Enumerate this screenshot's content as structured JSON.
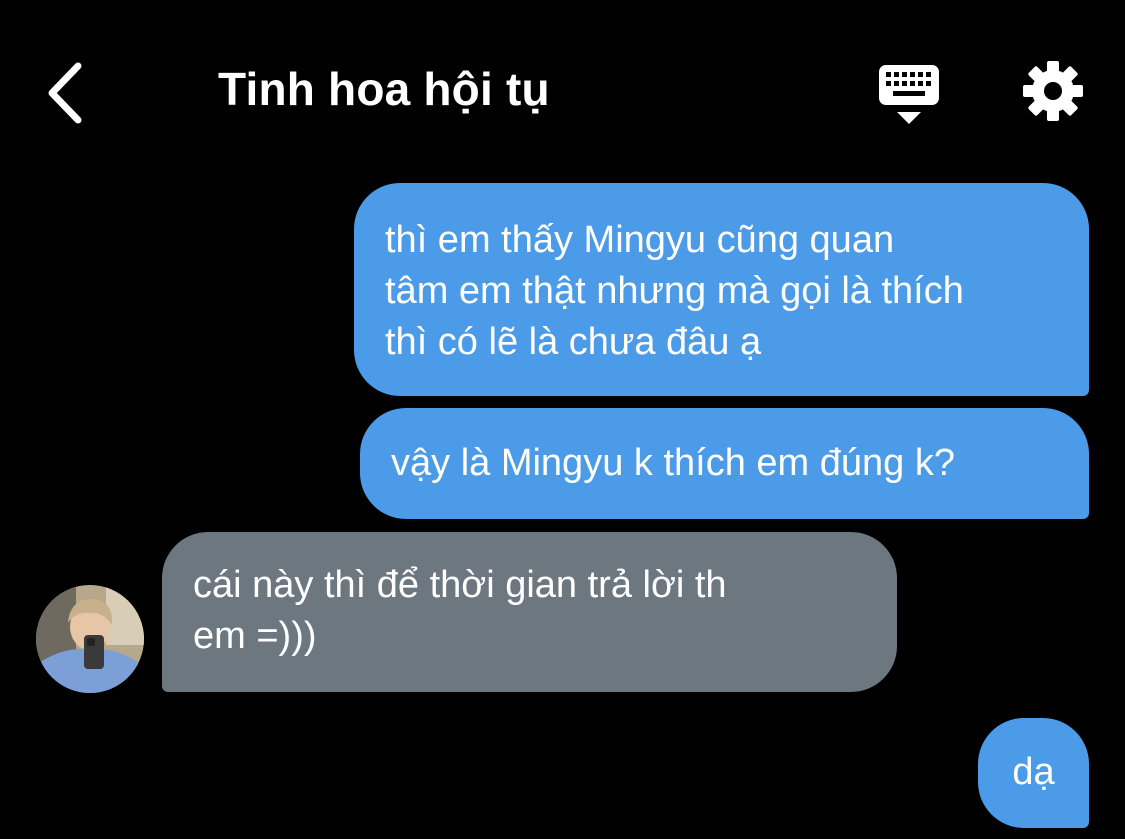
{
  "header": {
    "title": "Tinh hoa hội tụ",
    "back_icon": "chevron-left-icon",
    "keyboard_icon": "keyboard-icon",
    "settings_icon": "gear-icon"
  },
  "messages": [
    {
      "sender": "me",
      "text": "thì em thấy Mingyu cũng quan\ntâm em thật nhưng mà gọi là thích\nthì có lẽ là chưa đâu ạ"
    },
    {
      "sender": "me",
      "text": "vậy là Mingyu k thích em đúng k?"
    },
    {
      "sender": "other",
      "text": "cái này thì để thời gian trả lời th\nem =)))"
    },
    {
      "sender": "me",
      "text": "dạ"
    }
  ],
  "colors": {
    "background": "#000000",
    "sent_bubble": "#4b9be8",
    "received_bubble": "#6c7780",
    "text": "#ffffff"
  }
}
